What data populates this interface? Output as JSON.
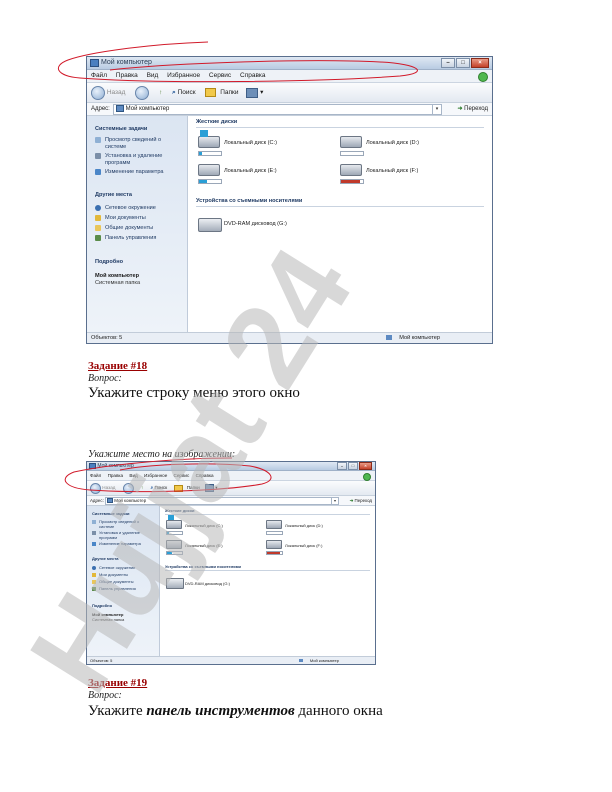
{
  "window1": {
    "title": "Мой компьютер",
    "menu": [
      "Файл",
      "Правка",
      "Вид",
      "Избранное",
      "Сервис",
      "Справка"
    ],
    "toolbar": {
      "back": "Назад",
      "search": "Поиск",
      "folders": "Папки"
    },
    "address": {
      "label": "Адрес:",
      "value": "Мой компьютер",
      "go": "Переход"
    },
    "sidebar": {
      "tasks_header": "Системные задачи",
      "tasks": [
        "Просмотр сведений о системе",
        "Установка и удаление программ",
        "Изменение параметра"
      ],
      "places_header": "Другие места",
      "places": [
        "Сетевое окружение",
        "Мои документы",
        "Общие документы",
        "Панель управления"
      ],
      "details_header": "Подробно",
      "details_title": "Мой компьютер",
      "details_sub": "Системная папка"
    },
    "drives_header": "Жесткие диски",
    "drives": [
      {
        "label": "Локальный диск (C:)",
        "fill": 0.12,
        "color": "#2a9fd6"
      },
      {
        "label": "Локальный диск (D:)",
        "fill": 0.0,
        "color": "#2a9fd6"
      },
      {
        "label": "Локальный диск (E:)",
        "fill": 0.35,
        "color": "#2a9fd6"
      },
      {
        "label": "Локальный диск (F:)",
        "fill": 0.85,
        "color": "#c0392b"
      }
    ],
    "removable_header": "Устройства со съемными носителями",
    "dvd_label": "DVD-RAM дисковод (G:)",
    "status_left": "Объектов: 5",
    "status_right": "Мой компьютер"
  },
  "window2": {
    "title": "Мой компьютер",
    "menu": [
      "Файл",
      "Правка",
      "Вид",
      "Избранное",
      "Сервис",
      "Справка"
    ],
    "toolbar": {
      "back": "Назад",
      "search": "Поиск",
      "folders": "Папки"
    },
    "address": {
      "label": "Адрес:",
      "value": "Мой компьютер",
      "go": "Переход"
    },
    "sidebar": {
      "tasks_header": "Системные задачи",
      "tasks": [
        "Просмотр сведений о системе",
        "Установка и удаление программ",
        "Изменение параметра"
      ],
      "places_header": "Другие места",
      "places": [
        "Сетевое окружение",
        "Мои документы",
        "Общие документы",
        "Панель управления"
      ],
      "details_header": "Подробно",
      "details_title": "Мой компьютер",
      "details_sub": "Системная папка"
    },
    "drives_header": "Жесткие диски",
    "drives": [
      {
        "label": "Локальный диск (C:)",
        "fill": 0.12,
        "color": "#2a9fd6"
      },
      {
        "label": "Локальный диск (D:)",
        "fill": 0.0,
        "color": "#2a9fd6"
      },
      {
        "label": "Локальный диск (E:)",
        "fill": 0.35,
        "color": "#2a9fd6"
      },
      {
        "label": "Локальный диск (F:)",
        "fill": 0.85,
        "color": "#c0392b"
      }
    ],
    "removable_header": "Устройства со съемными носителями",
    "dvd_label": "DVD-RAM дисковод (G:)",
    "status_left": "Объектов: 5",
    "status_right": "Мой компьютер"
  },
  "q18": {
    "title": "Задание #18",
    "sub": "Вопрос:",
    "text": "Укажите строку меню этого окно",
    "hint": "Укажите место на изображении:"
  },
  "q19": {
    "title": "Задание #19",
    "sub": "Вопрос:",
    "text_before": "Укажите ",
    "text_emph": "панель инструментов",
    "text_after": " данного окна"
  },
  "watermark": "Hujjat 24",
  "colors": {
    "accent_red": "#990000",
    "annotation": "#d11a2a",
    "watermark": "#b8b8b8"
  }
}
